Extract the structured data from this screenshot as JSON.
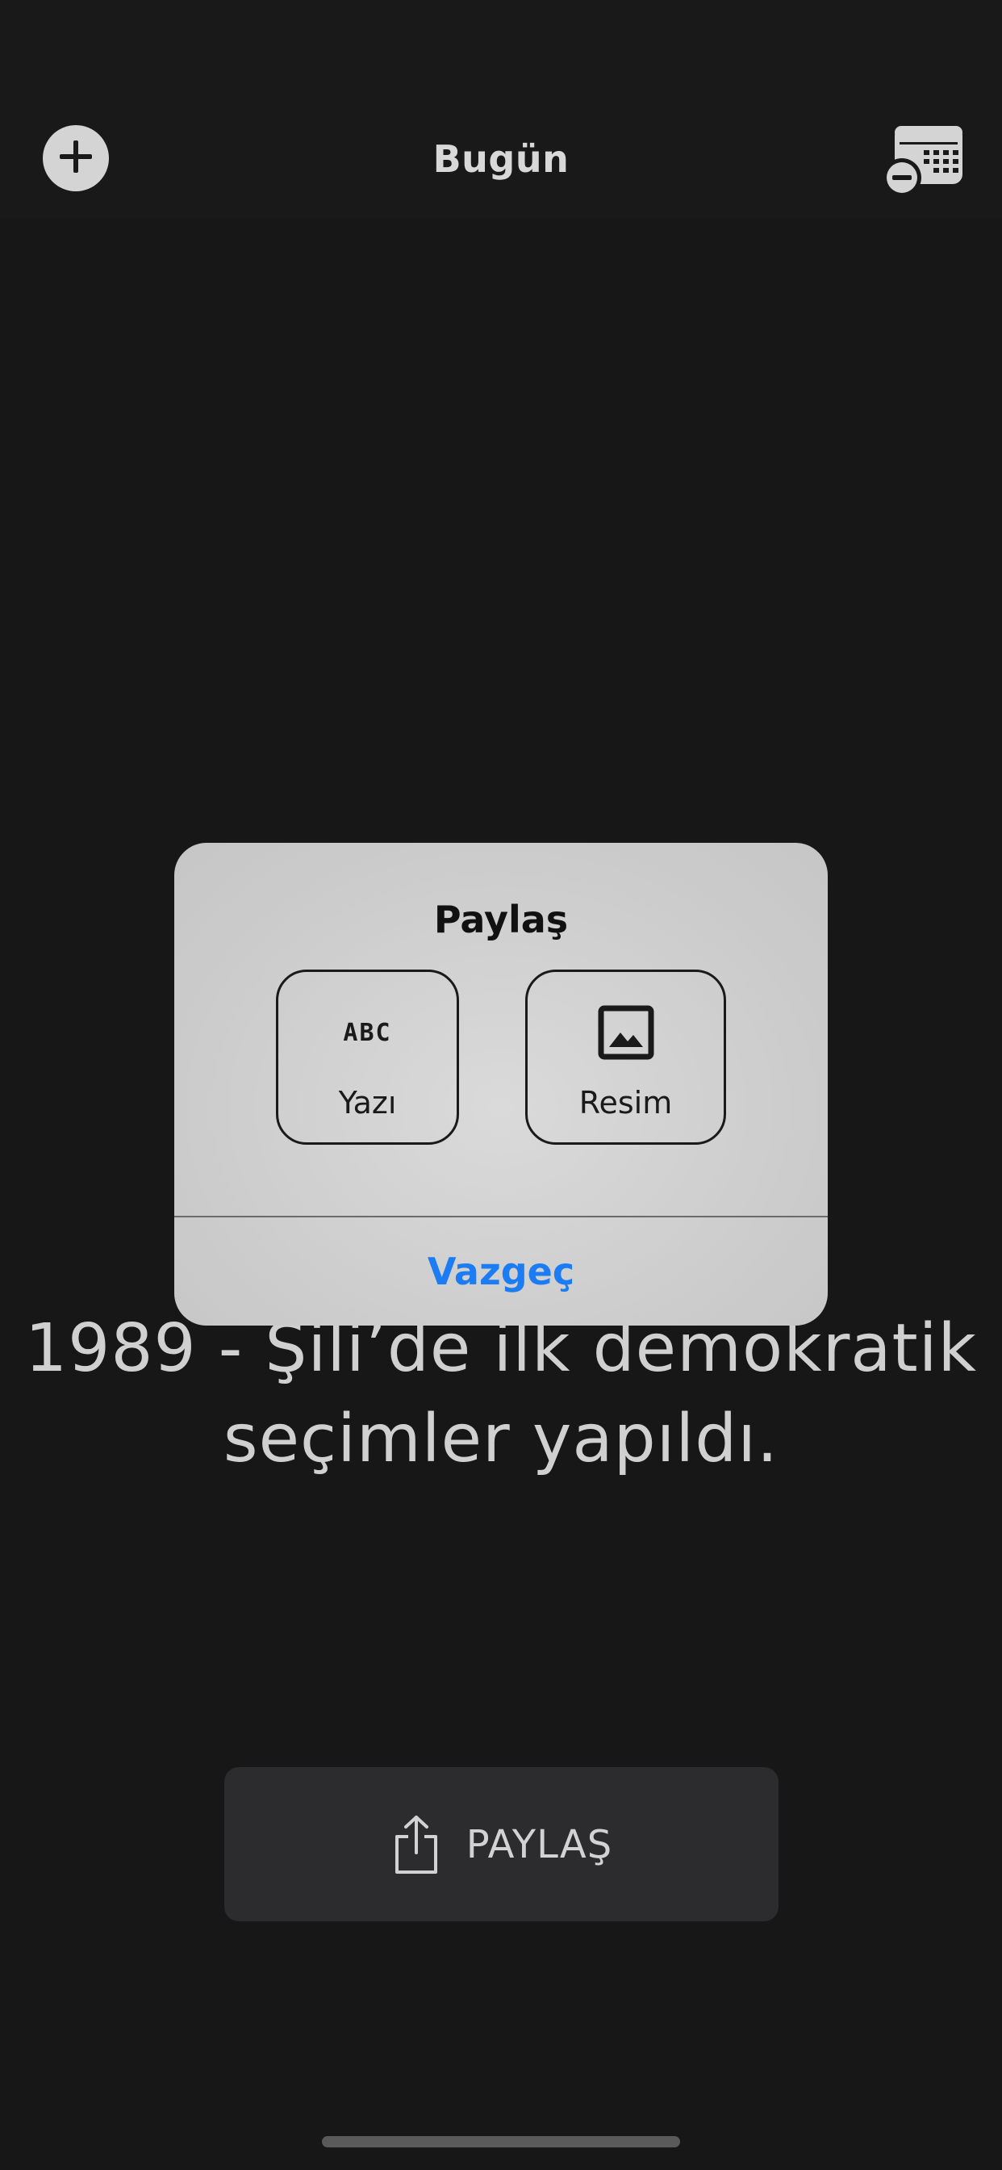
{
  "header": {
    "title": "Bugün",
    "add_icon": "plus-circle-icon",
    "calendar_icon": "calendar-minus-icon"
  },
  "event": {
    "line1": "1989 - Şili’de ilk demokratik",
    "line2": "seçimler yapıldı."
  },
  "share_button": {
    "label": "PAYLAŞ",
    "icon": "share-icon"
  },
  "dialog": {
    "title": "Paylaş",
    "options": [
      {
        "label": "Yazı",
        "icon": "abc-text-icon",
        "glyph": "ABC"
      },
      {
        "label": "Resim",
        "icon": "image-icon"
      }
    ],
    "cancel_label": "Vazgeç"
  },
  "colors": {
    "background": "#171717",
    "accent": "#1c7cf4",
    "dialog_bg": "#cfcfcf"
  }
}
